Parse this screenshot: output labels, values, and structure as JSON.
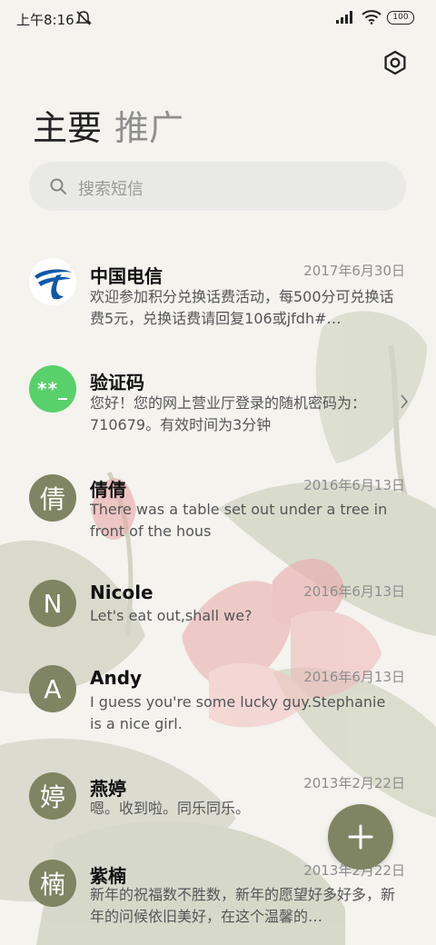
{
  "status_bar": {
    "time": "上午8:16",
    "battery": "100",
    "icons": [
      "mute-icon",
      "signal-icon",
      "wifi-icon",
      "battery-icon"
    ]
  },
  "header": {
    "settings_icon": "settings-icon",
    "tabs": [
      {
        "label": "主要",
        "active": true
      },
      {
        "label": "推广",
        "active": false
      }
    ]
  },
  "search": {
    "placeholder": "搜索短信",
    "icon": "search-icon"
  },
  "conversations": [
    {
      "name": "中国电信",
      "date": "2017年6月30日",
      "preview": "欢迎参加积分兑换话费活动，每500分可兑换话费5元，兑换话费请回复106或jfdh#…",
      "avatar": "",
      "avatar_type": "telecom-logo"
    },
    {
      "name": "验证码",
      "date": "",
      "preview": "您好！您的网上营业厅登录的随机密码为：710679。有效时间为3分钟",
      "avatar": "**_",
      "avatar_type": "code"
    },
    {
      "name": "倩倩",
      "date": "2016年6月13日",
      "preview": "There was a table set out under a tree in front of the hous",
      "avatar": "倩",
      "avatar_type": "initial"
    },
    {
      "name": "Nicole",
      "date": "2016年6月13日",
      "preview": "Let's eat out,shall we?",
      "avatar": "N",
      "avatar_type": "initial"
    },
    {
      "name": "Andy",
      "date": "2016年6月13日",
      "preview": "I guess you're some lucky guy.Stephanie is a nice girl.",
      "avatar": "A",
      "avatar_type": "initial"
    },
    {
      "name": "燕婷",
      "date": "2013年2月22日",
      "preview": "嗯。收到啦。同乐同乐。",
      "avatar": "婷",
      "avatar_type": "initial"
    },
    {
      "name": "紫楠",
      "date": "2013年2月22日",
      "preview": "新年的祝福数不胜数，新年的愿望好多好多，新年的问候依旧美好，在这个温馨的…",
      "avatar": "楠",
      "avatar_type": "initial"
    }
  ],
  "fab": {
    "icon": "plus-icon"
  },
  "colors": {
    "avatar": "#7f8462",
    "code_avatar": "#58d16b",
    "background": "#f4f3ee"
  }
}
